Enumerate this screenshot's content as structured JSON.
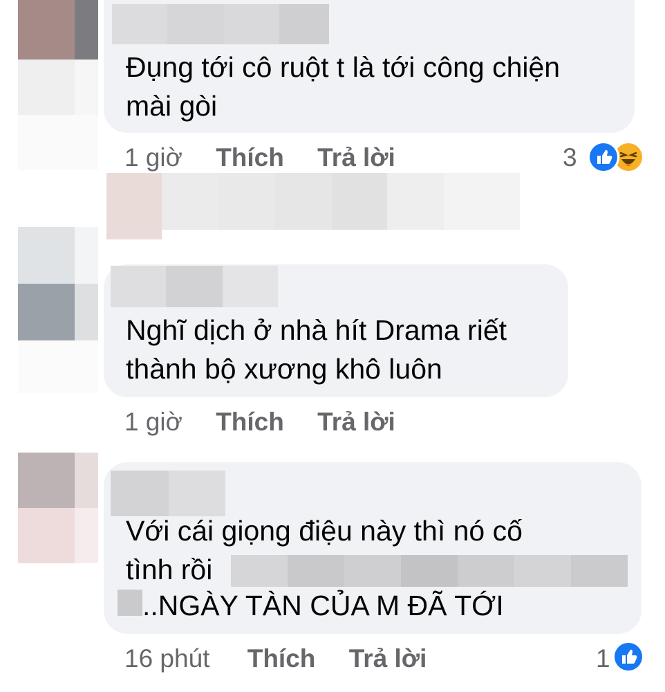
{
  "comments": [
    {
      "text_lines": [
        "Đụng tới cô ruột t là tới công chiện",
        "mài gòi"
      ],
      "time": "1 giờ",
      "like_label": "Thích",
      "reply_label": "Trả lời",
      "reaction_count": "3",
      "reaction_icons": [
        "like-icon",
        "haha-icon"
      ]
    },
    {
      "text_lines": [
        "Nghĩ dịch ở nhà hít Drama riết",
        "thành bộ xương khô luôn"
      ],
      "time": "1 giờ",
      "like_label": "Thích",
      "reply_label": "Trả lời"
    },
    {
      "text_lines": [
        "Với cái giọng điệu này thì nó cố",
        "tình rồi",
        "..NGÀY TÀN CỦA M ĐÃ TỚI"
      ],
      "time": "16 phút",
      "like_label": "Thích",
      "reply_label": "Trả lời",
      "reaction_count": "1",
      "reaction_icons": [
        "like-icon"
      ]
    }
  ],
  "colors": {
    "bubble": "#f0f2f5",
    "meta_text": "#65676b",
    "like_blue": "#1877f2",
    "haha_yellow": "#f7b125"
  }
}
